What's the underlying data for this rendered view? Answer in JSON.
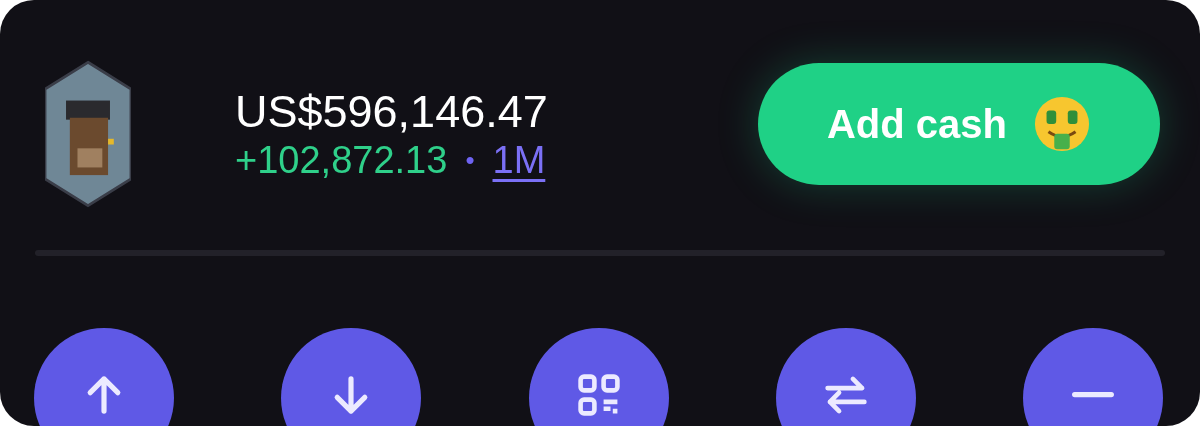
{
  "balance": "US$596,146.47",
  "change": {
    "amount": "+102,872.13",
    "separator": "•",
    "period": "1M"
  },
  "add_cash_button": {
    "label": "Add cash"
  },
  "actions": [
    {
      "kind": "send"
    },
    {
      "kind": "receive"
    },
    {
      "kind": "scan"
    },
    {
      "kind": "swap"
    },
    {
      "kind": "more"
    }
  ]
}
